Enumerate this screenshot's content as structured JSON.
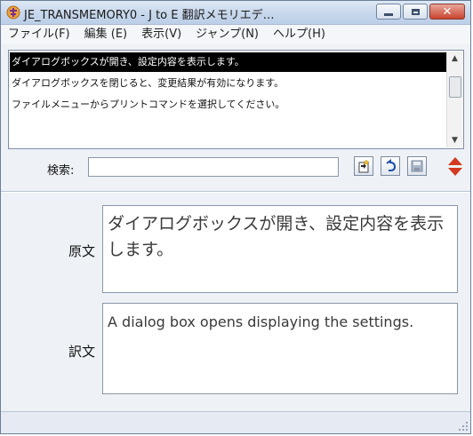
{
  "window": {
    "title": "JE_TRANSMEMORY0 - J to E 翻訳メモリエデ…"
  },
  "menu": [
    {
      "label": "ファイル(F)"
    },
    {
      "label": "編集 (E)"
    },
    {
      "label": "表示(V)"
    },
    {
      "label": "ジャンプ(N)"
    },
    {
      "label": "ヘルプ(H)"
    }
  ],
  "list": {
    "items": [
      {
        "label": "ダイアログボックスが開き、設定内容を表示します。",
        "selected": true
      },
      {
        "label": "ダイアログボックスを閉じると、変更結果が有効になります。",
        "selected": false
      },
      {
        "label": "ファイルメニューからプリントコマンドを選択してください。",
        "selected": false
      }
    ]
  },
  "search": {
    "label": "検索:",
    "value": ""
  },
  "source": {
    "label": "原文",
    "text": "ダイアログボックスが開き、設定内容を表示します。"
  },
  "translation": {
    "label": "訳文",
    "text": "A dialog box opens displaying the settings."
  },
  "colors": {
    "selection": "#000000",
    "spinner": "#d33a1f",
    "close_button": "#c7442e"
  }
}
